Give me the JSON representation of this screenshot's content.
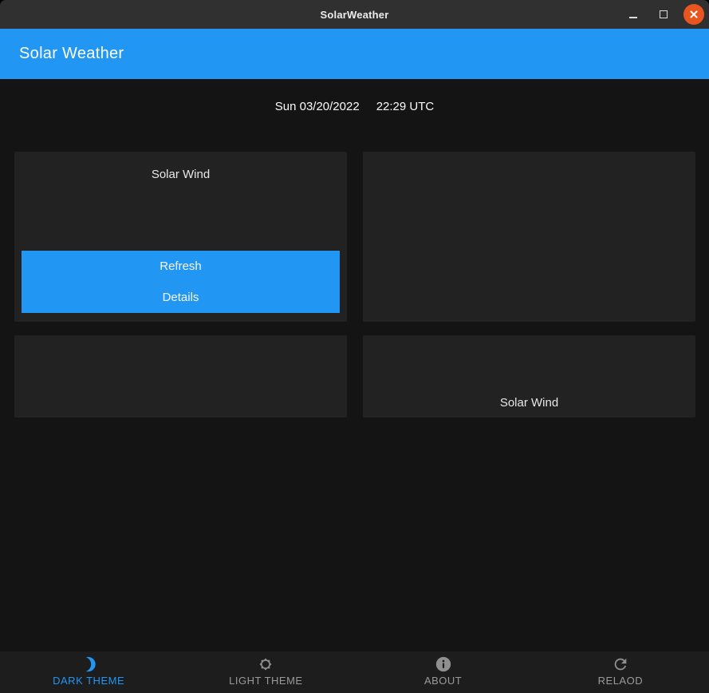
{
  "window": {
    "title": "SolarWeather"
  },
  "header": {
    "title": "Solar Weather"
  },
  "datetime": {
    "date": "Sun 03/20/2022",
    "time": "22:29 UTC"
  },
  "cards": {
    "solar_wind_top": {
      "title": "Solar Wind",
      "buttons": [
        {
          "label": "Refresh"
        },
        {
          "label": "Details"
        }
      ]
    },
    "solar_wind_bottom": {
      "title": "Solar Wind"
    }
  },
  "nav": {
    "items": [
      {
        "label": "DARK THEME",
        "icon": "moon-icon",
        "active": true
      },
      {
        "label": "LIGHT THEME",
        "icon": "sun-icon",
        "active": false
      },
      {
        "label": "ABOUT",
        "icon": "info-icon",
        "active": false
      },
      {
        "label": "RELAOD",
        "icon": "reload-icon",
        "active": false
      }
    ]
  },
  "colors": {
    "accent": "#2196F3",
    "close_button": "#E9551F",
    "background": "#141414",
    "card": "#222222",
    "titlebar": "#303030",
    "nav_background": "#1d1d1d",
    "nav_inactive": "#9a9a9a"
  }
}
